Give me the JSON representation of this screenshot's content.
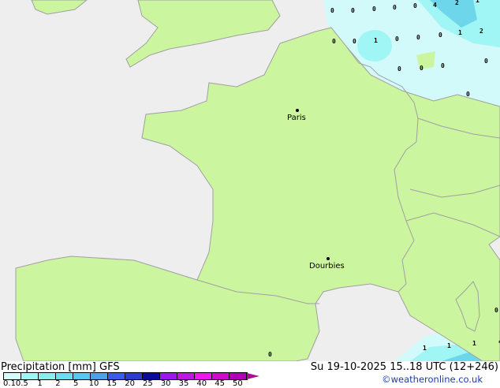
{
  "map": {
    "colors": {
      "sea": "#eeeeee",
      "land": "#ccf5a0",
      "border": "#a0a0a0",
      "light_precip": "#d2fafa",
      "medium_precip": "#a0f5f5",
      "heavy_precip": "#6ed6ea"
    },
    "cities": [
      {
        "name": "Paris"
      },
      {
        "name": "Dourbies"
      }
    ],
    "precip_values": [
      "0",
      "0",
      "0",
      "0",
      "0",
      "4",
      "2",
      "1",
      "0",
      "1",
      "0",
      "0",
      "0",
      "1",
      "2",
      "0",
      "0",
      "0",
      "0",
      "0",
      "0",
      "1",
      "1",
      "1",
      "0",
      "4",
      "0"
    ]
  },
  "footer": {
    "title": "Precipitation [mm]  GFS",
    "datetime": "Su 19-10-2025 15..18 UTC (12+246)",
    "credit": "©weatheronline.co.uk",
    "scale": {
      "labels": [
        "0.1",
        "0.5",
        "1",
        "2",
        "5",
        "10",
        "15",
        "20",
        "25",
        "30",
        "35",
        "40",
        "45",
        "50"
      ],
      "colors": [
        "#d4fafa",
        "#a0f5f5",
        "#8cebeb",
        "#6edcee",
        "#5ac8ee",
        "#4ea0e8",
        "#3c5af0",
        "#2d3cd2",
        "#0a0aa0",
        "#9b19f0",
        "#be14e6",
        "#f014f0",
        "#d20ac8",
        "#b400b4"
      ],
      "arrow_color": "#a0148c"
    }
  }
}
